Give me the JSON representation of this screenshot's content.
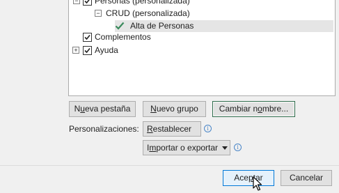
{
  "tree": {
    "items": [
      {
        "label": "Personas (personalizada)",
        "expander": "−",
        "checked": true
      },
      {
        "label": "CRUD (personalizada)",
        "expander": "−"
      },
      {
        "label": "Alta de Personas",
        "selected": true
      },
      {
        "label": "Complementos",
        "checked": true
      },
      {
        "label": "Ayuda",
        "expander": "+",
        "checked": true
      }
    ]
  },
  "buttons": {
    "new_tab": {
      "pre": "N",
      "accel": "u",
      "post": "eva pestaña"
    },
    "new_group": {
      "pre": "",
      "accel": "N",
      "post": "uevo grupo"
    },
    "rename": {
      "pre": "Cambiar n",
      "accel": "o",
      "post": "mbre..."
    }
  },
  "customizations": {
    "label": "Personalizaciones:",
    "reset": {
      "pre": "",
      "accel": "R",
      "post": "establecer"
    },
    "import_export": {
      "pre": "I",
      "accel": "m",
      "post": "portar o exportar"
    },
    "info_glyph": "i"
  },
  "footer": {
    "accept": {
      "pre": "Ace",
      "accel": "p",
      "post": "tar"
    },
    "cancel": "Cancelar"
  },
  "colors": {
    "checkmark": "#3a8a5c",
    "focus_border": "#2d6a4a",
    "info": "#4a86c8"
  }
}
